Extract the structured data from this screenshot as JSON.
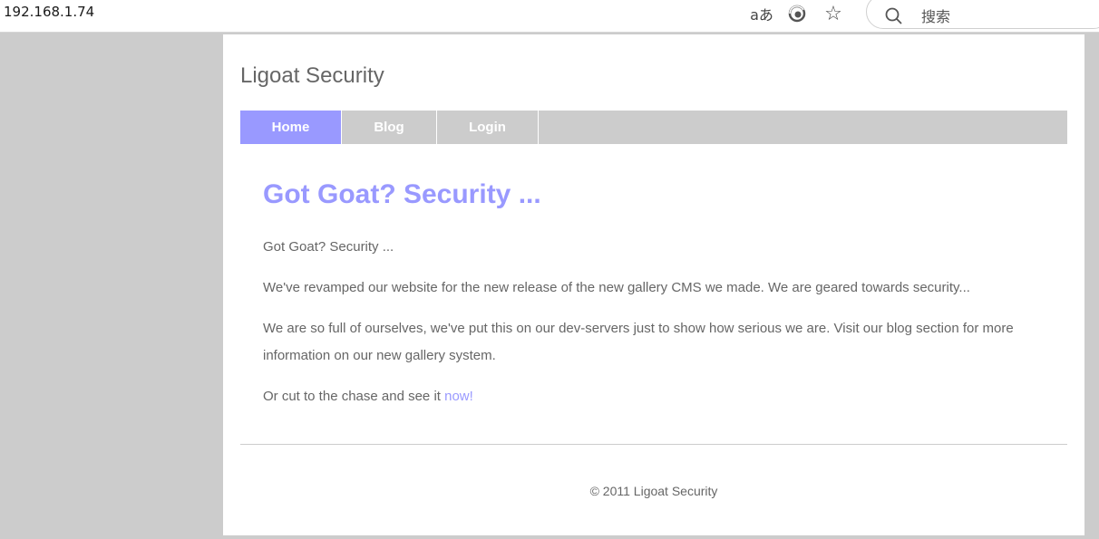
{
  "browser": {
    "url": "192.168.1.74",
    "search_placeholder": "搜索",
    "read_aloud_label": "aあ",
    "icons": [
      "read-aloud-icon",
      "edge-refresh-icon",
      "favorite-star-icon",
      "search-icon"
    ]
  },
  "site": {
    "title": "Ligoat Security"
  },
  "nav": {
    "items": [
      {
        "label": "Home",
        "active": true
      },
      {
        "label": "Blog",
        "active": false
      },
      {
        "label": "Login",
        "active": false
      }
    ]
  },
  "main": {
    "heading": "Got Goat? Security ...",
    "para1": "Got Goat? Security ...",
    "para2": "We've revamped our website for the new release of the new gallery CMS we made. We are geared towards security...",
    "para3": "We are so full of ourselves, we've put this on our dev-servers just to show how serious we are. Visit our blog section for more information on our new gallery system.",
    "para4_prefix": "Or cut to the chase and see it ",
    "para4_link": "now!"
  },
  "footer": {
    "text": "© 2011 Ligoat Security"
  },
  "colors": {
    "accent": "#9999ff",
    "nav_bg": "#cccccc",
    "text": "#666666",
    "page_bg": "#ffffff",
    "outer_bg": "#cccccc"
  }
}
